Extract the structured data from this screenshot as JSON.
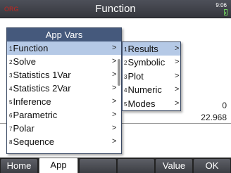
{
  "titlebar": {
    "mode_text": "ORG",
    "title": "Function",
    "clock": "9:06",
    "battery_color": "#6fcf5f"
  },
  "history": {
    "line1": "0",
    "line2": "22.968"
  },
  "menu": {
    "title": "App Vars",
    "items": [
      {
        "num": "1",
        "label": "Function",
        "arrow": ">"
      },
      {
        "num": "2",
        "label": "Solve",
        "arrow": ">"
      },
      {
        "num": "3",
        "label": "Statistics 1Var",
        "arrow": ">"
      },
      {
        "num": "4",
        "label": "Statistics 2Var",
        "arrow": ">"
      },
      {
        "num": "5",
        "label": "Inference",
        "arrow": ">"
      },
      {
        "num": "6",
        "label": "Parametric",
        "arrow": ">"
      },
      {
        "num": "7",
        "label": "Polar",
        "arrow": ">"
      },
      {
        "num": "8",
        "label": "Sequence",
        "arrow": ">"
      }
    ],
    "selected_index": 0
  },
  "submenu": {
    "items": [
      {
        "num": "1",
        "label": "Results",
        "arrow": ">"
      },
      {
        "num": "2",
        "label": "Symbolic",
        "arrow": ">"
      },
      {
        "num": "3",
        "label": "Plot",
        "arrow": ">"
      },
      {
        "num": "4",
        "label": "Numeric",
        "arrow": ">"
      },
      {
        "num": "5",
        "label": "Modes",
        "arrow": ">"
      }
    ],
    "selected_index": 0
  },
  "softkeys": {
    "k1": "Home",
    "k2": "App",
    "k3": "",
    "k4": "",
    "k5": "Value",
    "k6": "OK"
  },
  "colors": {
    "menu_header": "#45597c",
    "selection": "#b5c9e6",
    "titlebar": "#4d5059"
  }
}
